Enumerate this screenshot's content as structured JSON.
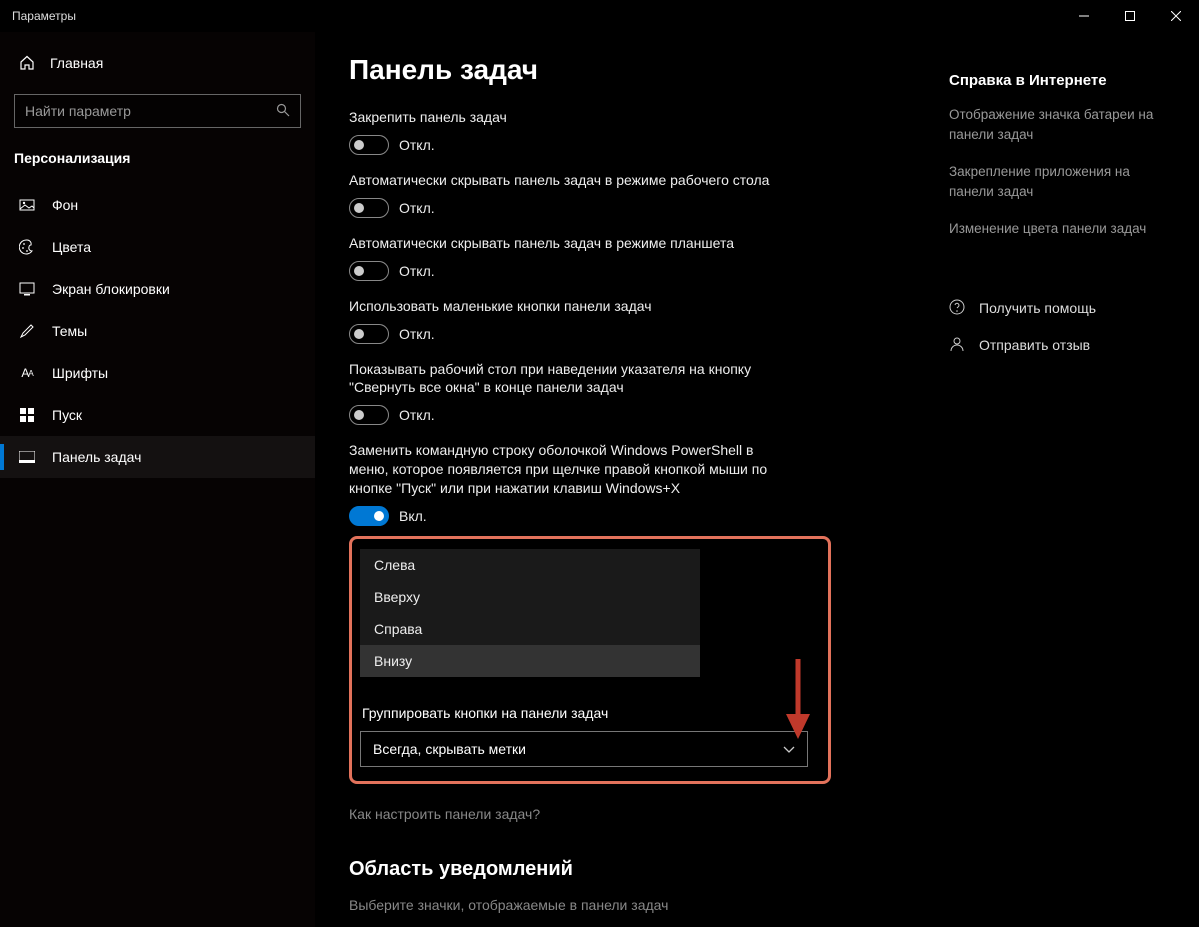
{
  "titlebar": {
    "title": "Параметры"
  },
  "sidebar": {
    "home": "Главная",
    "search_placeholder": "Найти параметр",
    "section": "Персонализация",
    "items": [
      {
        "label": "Фон"
      },
      {
        "label": "Цвета"
      },
      {
        "label": "Экран блокировки"
      },
      {
        "label": "Темы"
      },
      {
        "label": "Шрифты"
      },
      {
        "label": "Пуск"
      },
      {
        "label": "Панель задач"
      }
    ]
  },
  "page": {
    "title": "Панель задач",
    "toggles": [
      {
        "label": "Закрепить панель задач",
        "state": "Откл."
      },
      {
        "label": "Автоматически скрывать панель задач в режиме рабочего стола",
        "state": "Откл."
      },
      {
        "label": "Автоматически скрывать панель задач в режиме планшета",
        "state": "Откл."
      },
      {
        "label": "Использовать маленькие кнопки панели задач",
        "state": "Откл."
      },
      {
        "label": "Показывать рабочий стол при наведении указателя на кнопку \"Свернуть все окна\" в конце панели задач",
        "state": "Откл."
      },
      {
        "label": "Заменить командную строку оболочкой Windows PowerShell в меню, которое появляется при щелчке правой кнопкой мыши по кнопке \"Пуск\" или при нажатии клавиш Windows+X",
        "state": "Вкл.",
        "on": true
      }
    ],
    "position_options": [
      "Слева",
      "Вверху",
      "Справа",
      "Внизу"
    ],
    "group_label": "Группировать кнопки на панели задач",
    "group_value": "Всегда, скрывать метки",
    "help_link": "Как настроить панели задач?",
    "notif_heading": "Область уведомлений",
    "notif_sub": "Выберите значки, отображаемые в панели задач"
  },
  "aside": {
    "heading": "Справка в Интернете",
    "links": [
      "Отображение значка батареи на панели задач",
      "Закрепление приложения на панели задач",
      "Изменение цвета панели задач"
    ],
    "actions": [
      {
        "label": "Получить помощь"
      },
      {
        "label": "Отправить отзыв"
      }
    ]
  }
}
